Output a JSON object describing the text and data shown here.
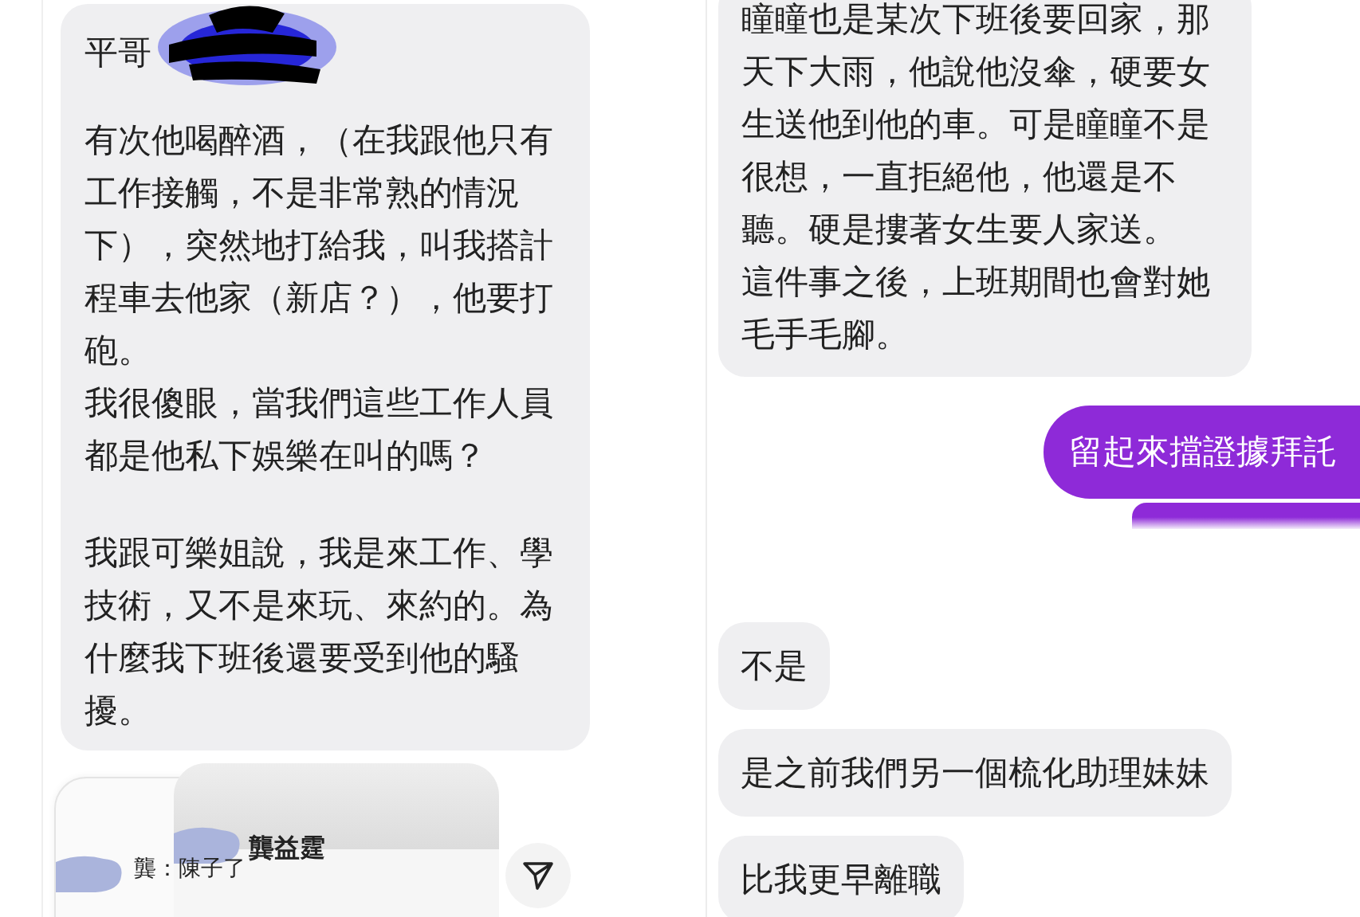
{
  "left_chat": {
    "bubble": {
      "name": "平哥",
      "redacted": true,
      "blocks": [
        [
          "有次他喝醉酒，（在我跟他只有工作接觸，不是非常熟的情況下），突然地打給我，叫我搭計程車去他家（新店？），他要打砲。",
          "我很傻眼，當我們這些工作人員都是他私下娛樂在叫的嗎？"
        ],
        [
          "我跟可樂姐說，我是來工作、學技術，又不是來玩、來約的。為什麼我下班後還要受到他的騷擾。"
        ]
      ]
    },
    "shared_screenshot": {
      "lines": [
        "龔益霆",
        "龔：陳子了"
      ]
    }
  },
  "right_chat": {
    "messages": [
      {
        "kind": "incoming",
        "paragraphs": [
          "瞳瞳也是某次下班後要回家，那天下大雨，他說他沒傘，硬要女生送他到他的車。可是瞳瞳不是很想，一直拒絕他，他還是不聽。硬是摟著女生要人家送。",
          "這件事之後，上班期間也會對她毛手毛腳。"
        ]
      },
      {
        "kind": "outgoing",
        "paragraphs": [
          "留起來擋證據拜託"
        ]
      },
      {
        "kind": "hidden_outgoing"
      },
      {
        "kind": "incoming",
        "paragraphs": [
          "不是"
        ]
      },
      {
        "kind": "incoming",
        "paragraphs": [
          "是之前我們另一個梳化助理妹妹"
        ]
      },
      {
        "kind": "incoming",
        "paragraphs": [
          "比我更早離職"
        ]
      }
    ]
  }
}
